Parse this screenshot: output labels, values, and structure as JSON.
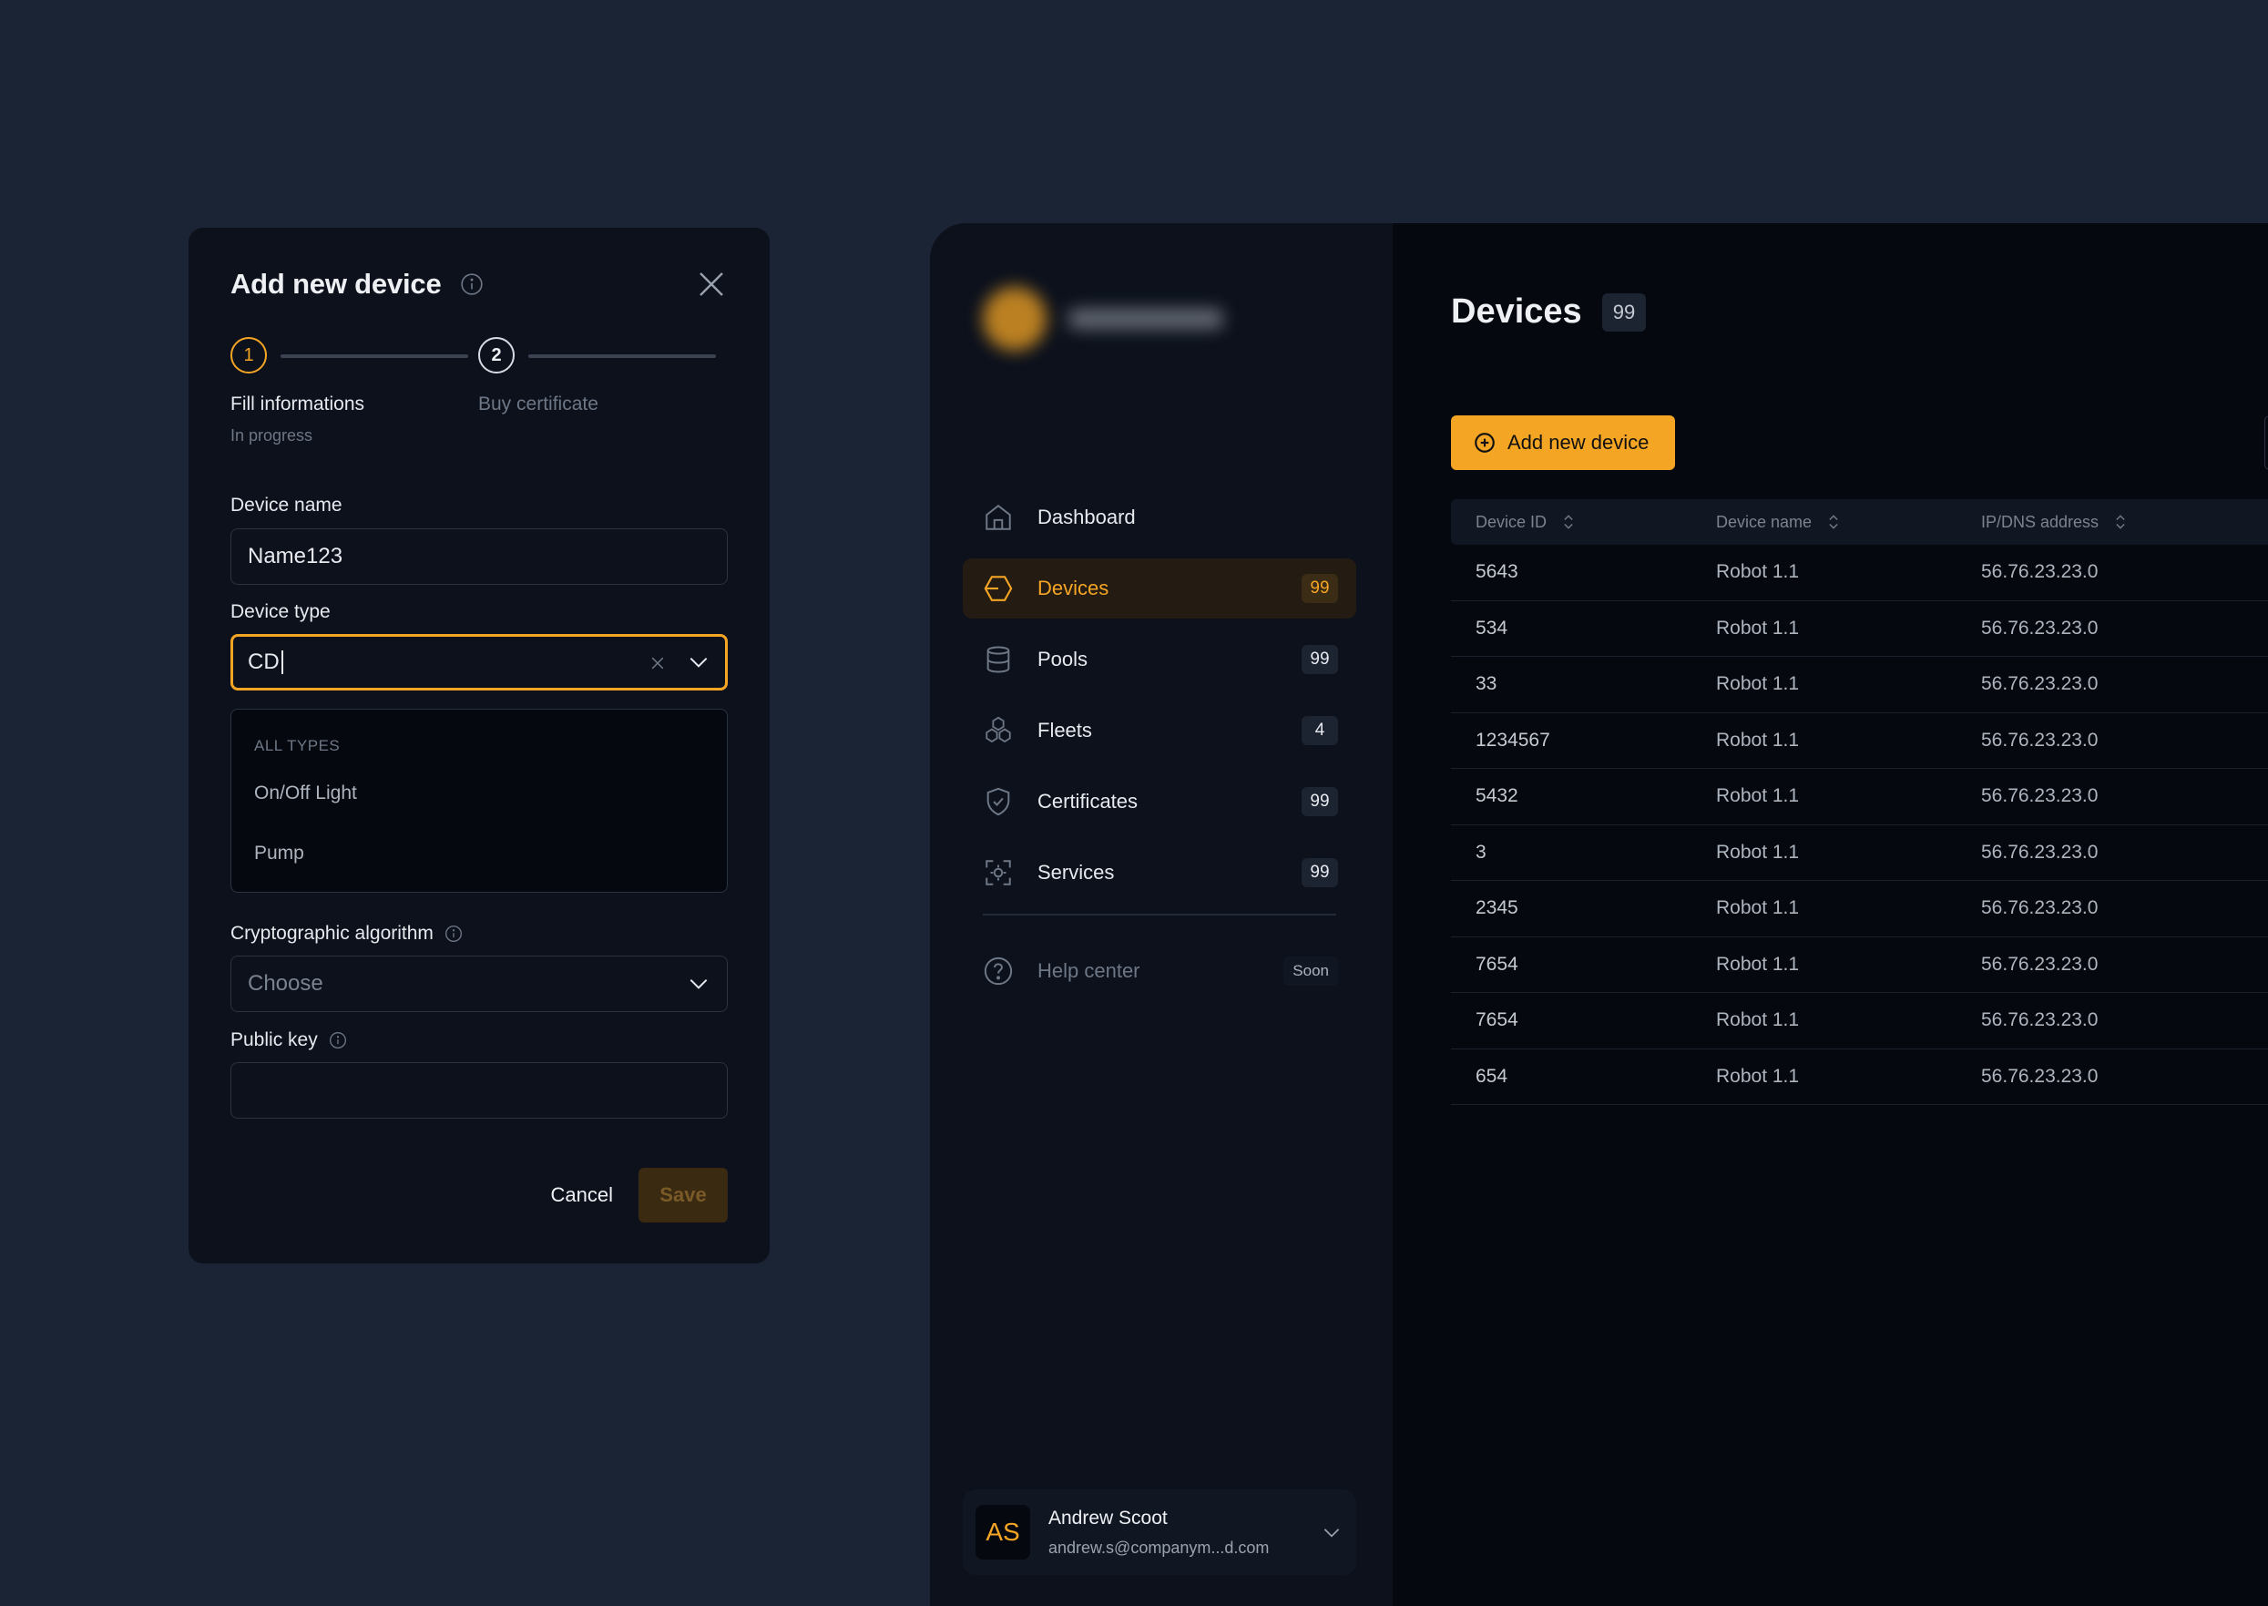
{
  "modal": {
    "title": "Add new device",
    "steps": [
      {
        "number": "1",
        "label": "Fill informations",
        "status": "In progress"
      },
      {
        "number": "2",
        "label": "Buy certificate"
      }
    ],
    "device_name": {
      "label": "Device name",
      "value": "Name123"
    },
    "device_type": {
      "label": "Device type",
      "value": "CD",
      "dropdown": {
        "header": "ALL TYPES",
        "options": [
          "On/Off Light",
          "Pump"
        ]
      }
    },
    "crypto": {
      "label": "Cryptographic algorithm",
      "placeholder": "Choose"
    },
    "public_key": {
      "label": "Public key",
      "value": ""
    },
    "cancel_label": "Cancel",
    "save_label": "Save"
  },
  "sidebar": {
    "items": [
      {
        "label": "Dashboard",
        "icon": "home-icon"
      },
      {
        "label": "Devices",
        "icon": "hexagon-icon",
        "count": "99",
        "active": true
      },
      {
        "label": "Pools",
        "icon": "database-icon",
        "count": "99"
      },
      {
        "label": "Fleets",
        "icon": "cubes-icon",
        "count": "4"
      },
      {
        "label": "Certificates",
        "icon": "shield-check-icon",
        "count": "99"
      },
      {
        "label": "Services",
        "icon": "scan-gear-icon",
        "count": "99"
      }
    ],
    "help": {
      "label": "Help center",
      "badge": "Soon",
      "icon": "help-circle-icon"
    },
    "user": {
      "initials": "AS",
      "name": "Andrew Scoot",
      "email": "andrew.s@companym...d.com"
    }
  },
  "main": {
    "title": "Devices",
    "count": "99",
    "add_button": "Add new device",
    "table": {
      "columns": [
        "Device ID",
        "Device name",
        "IP/DNS address"
      ],
      "rows": [
        [
          "5643",
          "Robot 1.1",
          "56.76.23.23.0"
        ],
        [
          "534",
          "Robot 1.1",
          "56.76.23.23.0"
        ],
        [
          "33",
          "Robot 1.1",
          "56.76.23.23.0"
        ],
        [
          "1234567",
          "Robot 1.1",
          "56.76.23.23.0"
        ],
        [
          "5432",
          "Robot 1.1",
          "56.76.23.23.0"
        ],
        [
          "3",
          "Robot 1.1",
          "56.76.23.23.0"
        ],
        [
          "2345",
          "Robot 1.1",
          "56.76.23.23.0"
        ],
        [
          "7654",
          "Robot 1.1",
          "56.76.23.23.0"
        ],
        [
          "7654",
          "Robot 1.1",
          "56.76.23.23.0"
        ],
        [
          "654",
          "Robot 1.1",
          "56.76.23.23.0"
        ]
      ]
    }
  },
  "colors": {
    "accent": "#f5a524",
    "background": "#1b2435",
    "panel": "#0c111c",
    "app": "#05080f"
  }
}
